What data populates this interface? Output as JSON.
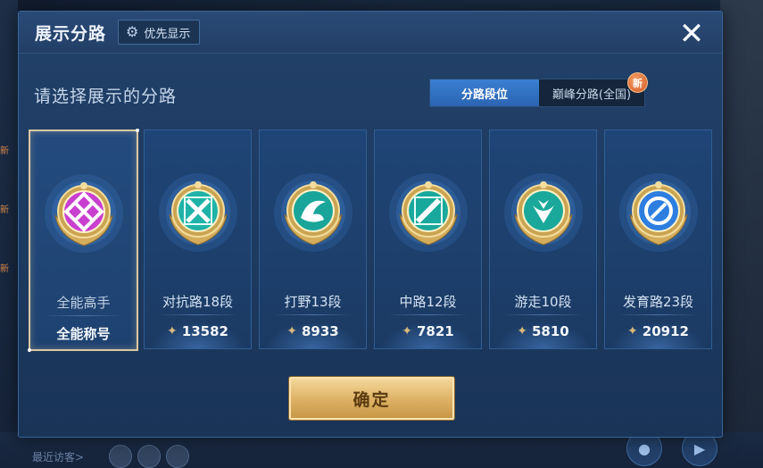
{
  "dialog": {
    "title": "展示分路",
    "priority_button": "优先显示",
    "subtitle": "请选择展示的分路",
    "close_icon": "close-icon",
    "confirm_label": "确定"
  },
  "tabs": [
    {
      "label": "分路段位",
      "active": true
    },
    {
      "label": "巅峰分路(全国)",
      "active": false,
      "badge": "新"
    }
  ],
  "cards": [
    {
      "label": "全能高手",
      "value": "全能称号",
      "selected": true,
      "icon": "all-round-medal-icon",
      "gem": "#c93fd0"
    },
    {
      "label": "对抗路18段",
      "value": "13582",
      "selected": false,
      "icon": "clash-lane-medal-icon",
      "gem": "#1fb3a8"
    },
    {
      "label": "打野13段",
      "value": "8933",
      "selected": false,
      "icon": "jungle-medal-icon",
      "gem": "#1aa59a"
    },
    {
      "label": "中路12段",
      "value": "7821",
      "selected": false,
      "icon": "mid-lane-medal-icon",
      "gem": "#19a89c"
    },
    {
      "label": "游走10段",
      "value": "5810",
      "selected": false,
      "icon": "roam-medal-icon",
      "gem": "#1aa89a"
    },
    {
      "label": "发育路23段",
      "value": "20912",
      "selected": false,
      "icon": "farm-lane-medal-icon",
      "gem": "#2d7ee0"
    }
  ],
  "background": {
    "recent_visitors_label": "最近访客>",
    "side_badge": "新"
  }
}
